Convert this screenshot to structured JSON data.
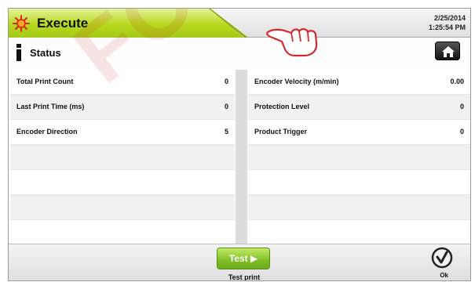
{
  "header": {
    "title": "Execute",
    "date": "2/25/2014",
    "time": "1:25:54 PM",
    "title_icon": "laser-starburst-icon",
    "accent_color": "#a5ca16"
  },
  "status": {
    "label": "Status",
    "icon": "info-icon",
    "home_icon": "home-icon"
  },
  "table": {
    "left": [
      {
        "label": "Total Print Count",
        "value": "0"
      },
      {
        "label": "Last Print Time (ms)",
        "value": "0"
      },
      {
        "label": "Encoder Direction",
        "value": "5"
      }
    ],
    "right": [
      {
        "label": "Encoder Velocity (m/min)",
        "value": "0.00"
      },
      {
        "label": "Protection Level",
        "value": "0"
      },
      {
        "label": "Product Trigger",
        "value": "0"
      }
    ]
  },
  "footer": {
    "test_button": "Test ▶",
    "test_caption": "Test print",
    "ok_caption": "Ok",
    "ok_icon": "checkmark-circle-icon",
    "pointer_icon": "pointing-hand-icon"
  },
  "watermark": "FOR"
}
